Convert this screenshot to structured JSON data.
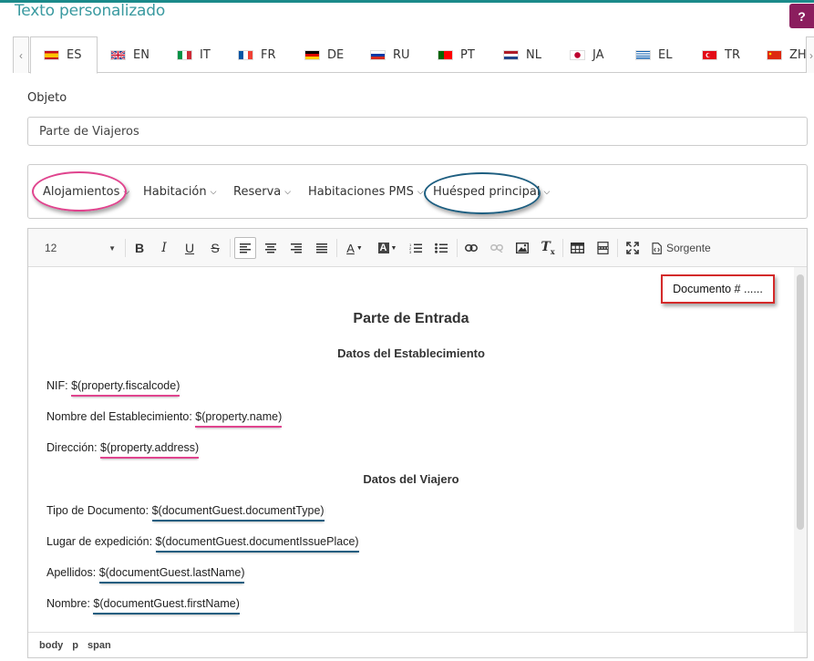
{
  "page": {
    "title": "Texto personalizado",
    "help_label": "?"
  },
  "languages": [
    {
      "code": "ES",
      "active": true
    },
    {
      "code": "EN",
      "active": false
    },
    {
      "code": "IT",
      "active": false
    },
    {
      "code": "FR",
      "active": false
    },
    {
      "code": "DE",
      "active": false
    },
    {
      "code": "RU",
      "active": false
    },
    {
      "code": "PT",
      "active": false
    },
    {
      "code": "NL",
      "active": false
    },
    {
      "code": "JA",
      "active": false
    },
    {
      "code": "EL",
      "active": false
    },
    {
      "code": "TR",
      "active": false
    },
    {
      "code": "ZH",
      "active": false
    }
  ],
  "tab_nav": {
    "prev": "‹",
    "next": "›"
  },
  "subject": {
    "label": "Objeto",
    "value": "Parte de Viajeros"
  },
  "placeholder_menu": {
    "items": [
      "Alojamientos",
      "Habitación",
      "Reserva",
      "Habitaciones PMS",
      "Huésped principal"
    ],
    "chevron": "⌵"
  },
  "toolbar": {
    "font_size": "12",
    "source_label": "Sorgente"
  },
  "content": {
    "doc_number": "Documento # ......",
    "title": "Parte de Entrada",
    "section1": "Datos del Establecimiento",
    "section2": "Datos del Viajero",
    "rows": [
      {
        "label": "NIF: ",
        "var": "$(property.fiscalcode)"
      },
      {
        "label": "Nombre del Establecimiento: ",
        "var": "$(property.name)"
      },
      {
        "label": "Dirección: ",
        "var": "$(property.address)"
      },
      {
        "label": "Tipo de Documento: ",
        "var": "$(documentGuest.documentType)"
      },
      {
        "label": "Lugar de expedición: ",
        "var": "$(documentGuest.documentIssuePlace)"
      },
      {
        "label": "Apellidos: ",
        "var": "$(documentGuest.lastName)"
      },
      {
        "label": "Nombre: ",
        "var": "$(documentGuest.firstName)"
      }
    ]
  },
  "path": [
    "body",
    "p",
    "span"
  ],
  "colors": {
    "accent": "#1b8a8a",
    "help": "#8b1e5e",
    "pink_mark": "#e0448e",
    "blue_mark": "#1d5e80",
    "red_box": "#d42a2a"
  }
}
